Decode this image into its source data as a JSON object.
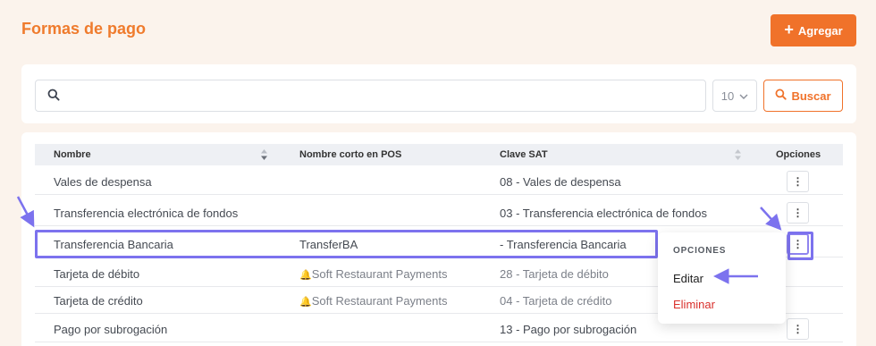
{
  "header": {
    "title": "Formas de pago",
    "add_label": "Agregar"
  },
  "search": {
    "placeholder": "",
    "page_size": "10",
    "button_label": "Buscar"
  },
  "table": {
    "columns": [
      "Nombre",
      "Nombre corto en POS",
      "Clave SAT",
      "Opciones"
    ],
    "rows": [
      {
        "nombre": "Vales de despensa",
        "corto": "",
        "clave": "08 - Vales de despensa"
      },
      {
        "nombre": "Transferencia electrónica de fondos",
        "corto": "",
        "clave": "03 - Transferencia electrónica de fondos"
      },
      {
        "nombre": "Transferencia Bancaria",
        "corto": "TransferBA",
        "clave": "- Transferencia Bancaria"
      },
      {
        "nombre": "Tarjeta de débito",
        "corto": "Soft Restaurant Payments",
        "clave": "28 - Tarjeta de débito"
      },
      {
        "nombre": "Tarjeta de crédito",
        "corto": "Soft Restaurant Payments",
        "clave": "04 - Tarjeta de crédito"
      },
      {
        "nombre": "Pago por subrogación",
        "corto": "",
        "clave": "13 - Pago por subrogación"
      }
    ]
  },
  "menu": {
    "header": "OPCIONES",
    "edit_label": "Editar",
    "delete_label": "Eliminar"
  },
  "colors": {
    "brand": "#f0722a",
    "annotation": "#7c72ee",
    "danger": "#d9302c"
  },
  "icons": {
    "search": "magnifier",
    "add": "plus",
    "options": "vertical-ellipsis",
    "sort": "up-down-arrows",
    "notification": "bell"
  }
}
